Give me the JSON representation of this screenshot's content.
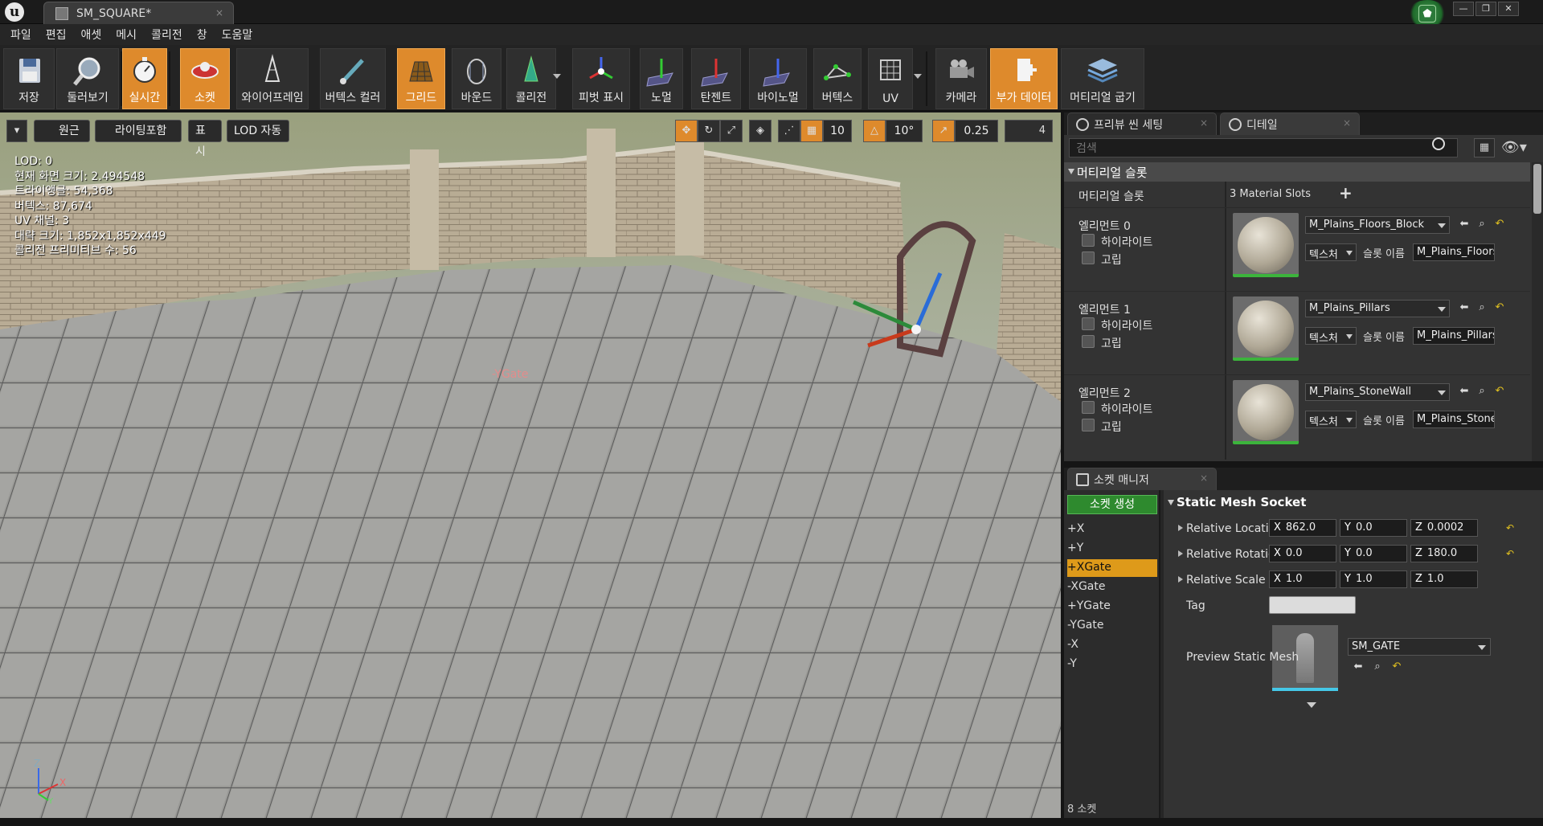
{
  "titlebar": {
    "tab_title": "SM_SQUARE*",
    "close": "×",
    "window_buttons": [
      "—",
      "❐",
      "✕"
    ]
  },
  "menubar": {
    "items": [
      "파일",
      "편집",
      "애셋",
      "메시",
      "콜리전",
      "창",
      "도움말"
    ]
  },
  "toolbar": {
    "save": "저장",
    "browse": "둘러보기",
    "realtime": "실시간",
    "socket": "소켓",
    "wireframe": "와이어프레임",
    "vertex_color": "버텍스 컬러",
    "grid": "그리드",
    "bounds": "바운드",
    "collision": "콜리전",
    "pivot": "피벗 표시",
    "normal": "노멀",
    "tangent": "탄젠트",
    "binormal": "바이노멀",
    "vertex": "버텍스",
    "uv": "UV",
    "camera": "카메라",
    "additional_data": "부가 데이터",
    "bake_materials": "머티리얼 굽기",
    "accent": "#de8a2c"
  },
  "viewport_toolbar": {
    "perspective": "원근",
    "lit": "라이팅포함",
    "show": "표시",
    "lod": "LOD 자동",
    "grid_snap": "10",
    "rot_snap": "10°",
    "scale_snap": "0.25",
    "cam_speed": "4"
  },
  "stats": {
    "lod": "LOD:  0",
    "screen_size": "현재 화면 크기: 2.494548",
    "triangles": "트라이앵글: 54,368",
    "vertices": "버텍스: 87,674",
    "uv_channels": "UV 채널:  3",
    "approx_size": "대략 크기: 1,852x1,852x449",
    "collision_prims": "콜리전 프리미티브 수: 56"
  },
  "viewport_label": "-YGate",
  "axis": {
    "z": "Z",
    "x": "X",
    "y": "Y"
  },
  "details_tabs": {
    "preview_scene": "프리뷰 씬 세팅",
    "details": "디테일"
  },
  "details": {
    "search_placeholder": "검색",
    "category": "머티리얼 슬롯",
    "slots_label": "머티리얼 슬롯",
    "slots_value": "3 Material Slots",
    "add": "+",
    "highlight": "하이라이트",
    "isolate": "고립",
    "texture": "텍스처",
    "slot_name_label": "슬롯 이름",
    "elements": [
      {
        "label": "엘리먼트 0",
        "material": "M_Plains_Floors_Block",
        "slot_name": "M_Plains_Floors_Block"
      },
      {
        "label": "엘리먼트 1",
        "material": "M_Plains_Pillars",
        "slot_name": "M_Plains_Pillars"
      },
      {
        "label": "엘리먼트 2",
        "material": "M_Plains_StoneWall",
        "slot_name": "M_Plains_StoneWall"
      }
    ]
  },
  "socket_manager": {
    "tab": "소켓 매니저",
    "create_button": "소켓 생성",
    "sockets": [
      "+X",
      "+Y",
      "+XGate",
      "-XGate",
      "+YGate",
      "-YGate",
      "-X",
      "-Y"
    ],
    "selected": "+XGate",
    "count": "8 소켓",
    "section": "Static Mesh Socket",
    "relative_location": {
      "label": "Relative Location",
      "x": "862.0",
      "y": "0.0",
      "z": "0.0002"
    },
    "relative_rotation": {
      "label": "Relative Rotation",
      "x": "0.0",
      "y": "0.0",
      "z": "180.0"
    },
    "relative_scale": {
      "label": "Relative Scale",
      "x": "1.0",
      "y": "1.0",
      "z": "1.0"
    },
    "tag_label": "Tag",
    "preview_label": "Preview Static Mesh",
    "preview_mesh": "SM_GATE"
  }
}
